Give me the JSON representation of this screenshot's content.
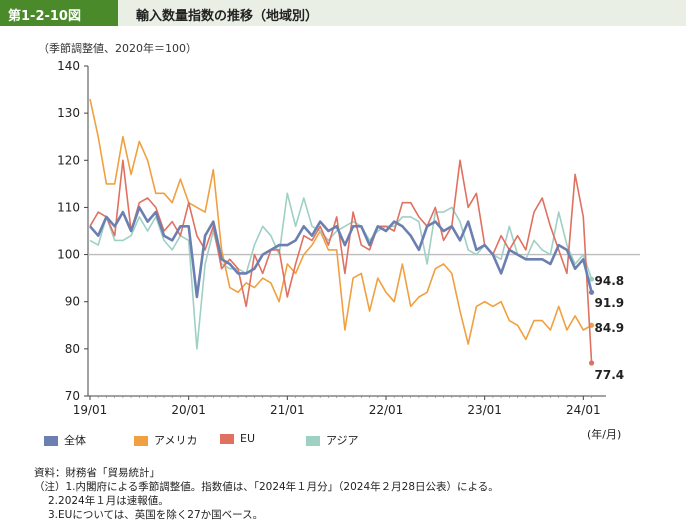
{
  "figure": {
    "number": "第1-2-10図",
    "title": "輸入数量指数の推移（地域別）",
    "unit_note": "（季節調整値、2020年＝100）",
    "x_unit": "(年/月)"
  },
  "notes": {
    "source": "資料：財務省「貿易統計」",
    "lines": [
      "（注）1.内閣府による季節調整値。指数値は、「2024年１月分」（2024年２月28日公表）による。",
      "2.2024年１月は速報値。",
      "3.EUについては、英国を除く27か国ベース。"
    ]
  },
  "colors": {
    "total": "#6b7fb0",
    "america": "#f0a040",
    "eu": "#e07060",
    "asia": "#9fd0c4",
    "header_bg": "#e9efe4",
    "header_accent": "#4a8a2a"
  },
  "chart_data": {
    "type": "line",
    "x_start": "2019-01",
    "x_end": "2024-01",
    "x_ticks": [
      "19/01",
      "20/01",
      "21/01",
      "22/01",
      "23/01",
      "24/01"
    ],
    "ylim": [
      70,
      140
    ],
    "y_ticks": [
      70,
      80,
      90,
      100,
      110,
      120,
      130,
      140
    ],
    "reference_line": 100,
    "grid": false,
    "legend_position": "bottom",
    "series": [
      {
        "name": "全体",
        "key": "total",
        "end_label": "91.9",
        "values": [
          106,
          104,
          108,
          106,
          109,
          105,
          110,
          107,
          109,
          104,
          103,
          106,
          106,
          91,
          104,
          107,
          99,
          98,
          96,
          96,
          97,
          100,
          101,
          102,
          102,
          103,
          106,
          104,
          107,
          105,
          106,
          102,
          106,
          106,
          102,
          106,
          105,
          107,
          106,
          104,
          101,
          106,
          107,
          105,
          106,
          103,
          107,
          101,
          102,
          100,
          96,
          101,
          100,
          99,
          99,
          99,
          98,
          102,
          101,
          97,
          99,
          92
        ]
      },
      {
        "name": "アメリカ",
        "key": "america",
        "end_label": "84.9",
        "values": [
          133,
          125,
          115,
          115,
          125,
          117,
          124,
          120,
          113,
          113,
          111,
          116,
          111,
          110,
          109,
          118,
          101,
          93,
          92,
          94,
          93,
          95,
          94,
          90,
          98,
          96,
          100,
          102,
          105,
          101,
          101,
          84,
          95,
          96,
          88,
          95,
          92,
          90,
          98,
          89,
          91,
          92,
          97,
          98,
          96,
          88,
          81,
          89,
          90,
          89,
          90,
          86,
          85,
          82,
          86,
          86,
          84,
          89,
          84,
          87,
          84,
          85
        ]
      },
      {
        "name": "EU",
        "key": "eu",
        "end_label": "77.4",
        "values": [
          106,
          109,
          108,
          104,
          120,
          105,
          111,
          112,
          110,
          105,
          107,
          104,
          111,
          104,
          101,
          106,
          97,
          99,
          97,
          89,
          100,
          96,
          101,
          101,
          91,
          98,
          104,
          103,
          106,
          102,
          108,
          96,
          109,
          102,
          101,
          106,
          106,
          105,
          111,
          111,
          108,
          106,
          110,
          103,
          106,
          120,
          110,
          113,
          102,
          100,
          104,
          101,
          104,
          101,
          109,
          112,
          106,
          101,
          96,
          117,
          108,
          77
        ]
      },
      {
        "name": "アジア",
        "key": "asia",
        "end_label": "94.8",
        "values": [
          103,
          102,
          108,
          103,
          103,
          104,
          108,
          105,
          108,
          103,
          101,
          104,
          103,
          80,
          98,
          105,
          98,
          97,
          97,
          96,
          102,
          106,
          104,
          100,
          113,
          106,
          112,
          106,
          105,
          103,
          105,
          106,
          107,
          106,
          103,
          105,
          106,
          106,
          108,
          108,
          107,
          98,
          109,
          109,
          110,
          107,
          101,
          100,
          102,
          100,
          99,
          106,
          100,
          99,
          103,
          101,
          100,
          109,
          102,
          98,
          100,
          94.8
        ]
      }
    ]
  }
}
